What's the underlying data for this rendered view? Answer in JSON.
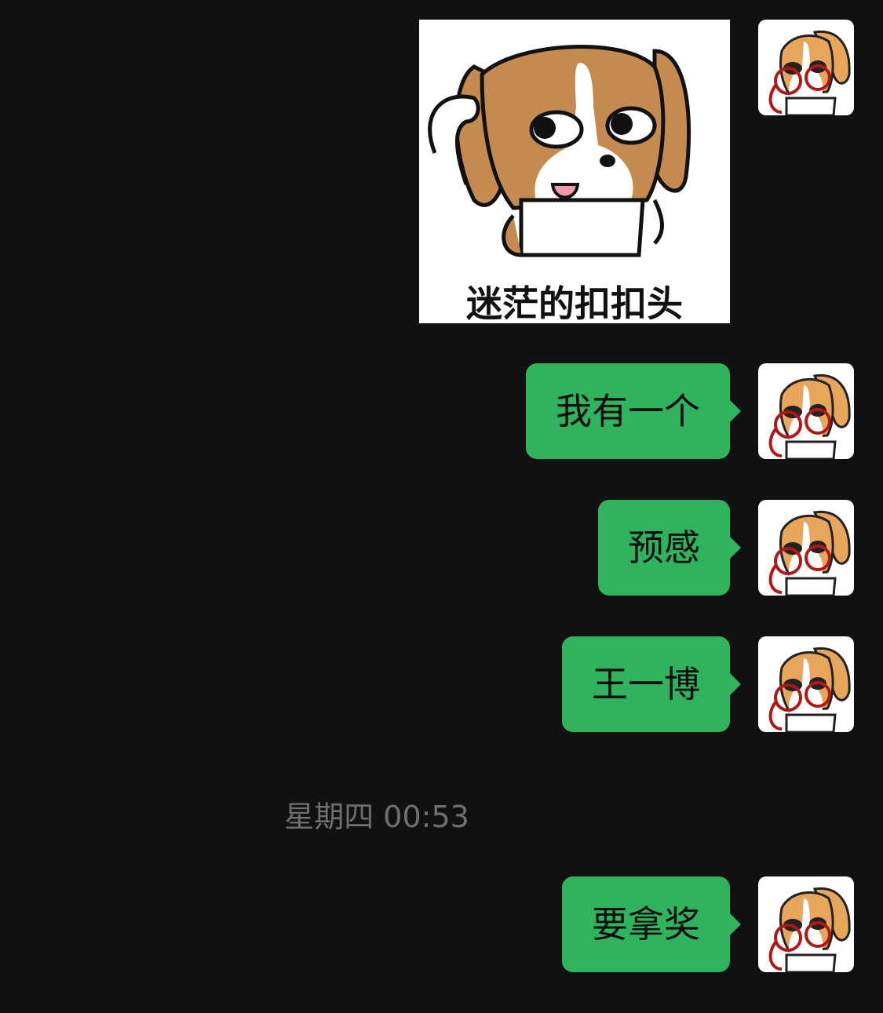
{
  "messages": [
    {
      "type": "sticker",
      "caption": "迷茫的扣扣头"
    },
    {
      "type": "text",
      "text": "我有一个"
    },
    {
      "type": "text",
      "text": "预感"
    },
    {
      "type": "text",
      "text": "王一博"
    },
    {
      "type": "text",
      "text": "要拿奖"
    }
  ],
  "divider": {
    "timestamp": "星期四 00:53"
  },
  "colors": {
    "background": "#111111",
    "bubble": "#2fb35e",
    "timestamp": "#6f6f6f"
  },
  "icons": {
    "avatar": "cartoon-dog-avatar-icon",
    "sticker": "confused-dog-sticker-icon"
  }
}
